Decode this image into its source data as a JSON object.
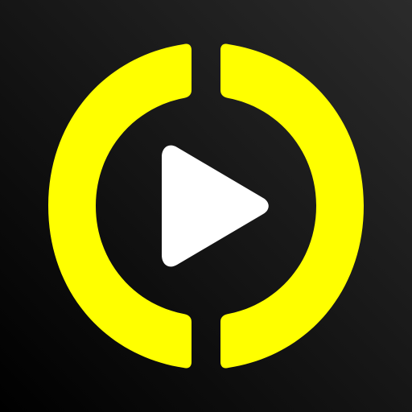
{
  "icon": {
    "name": "play-button-ring-logo",
    "background_top_right": "#2b2b2b",
    "background_bottom_left": "#000000",
    "ring_color": "#ffff00",
    "play_color": "#ffffff"
  }
}
